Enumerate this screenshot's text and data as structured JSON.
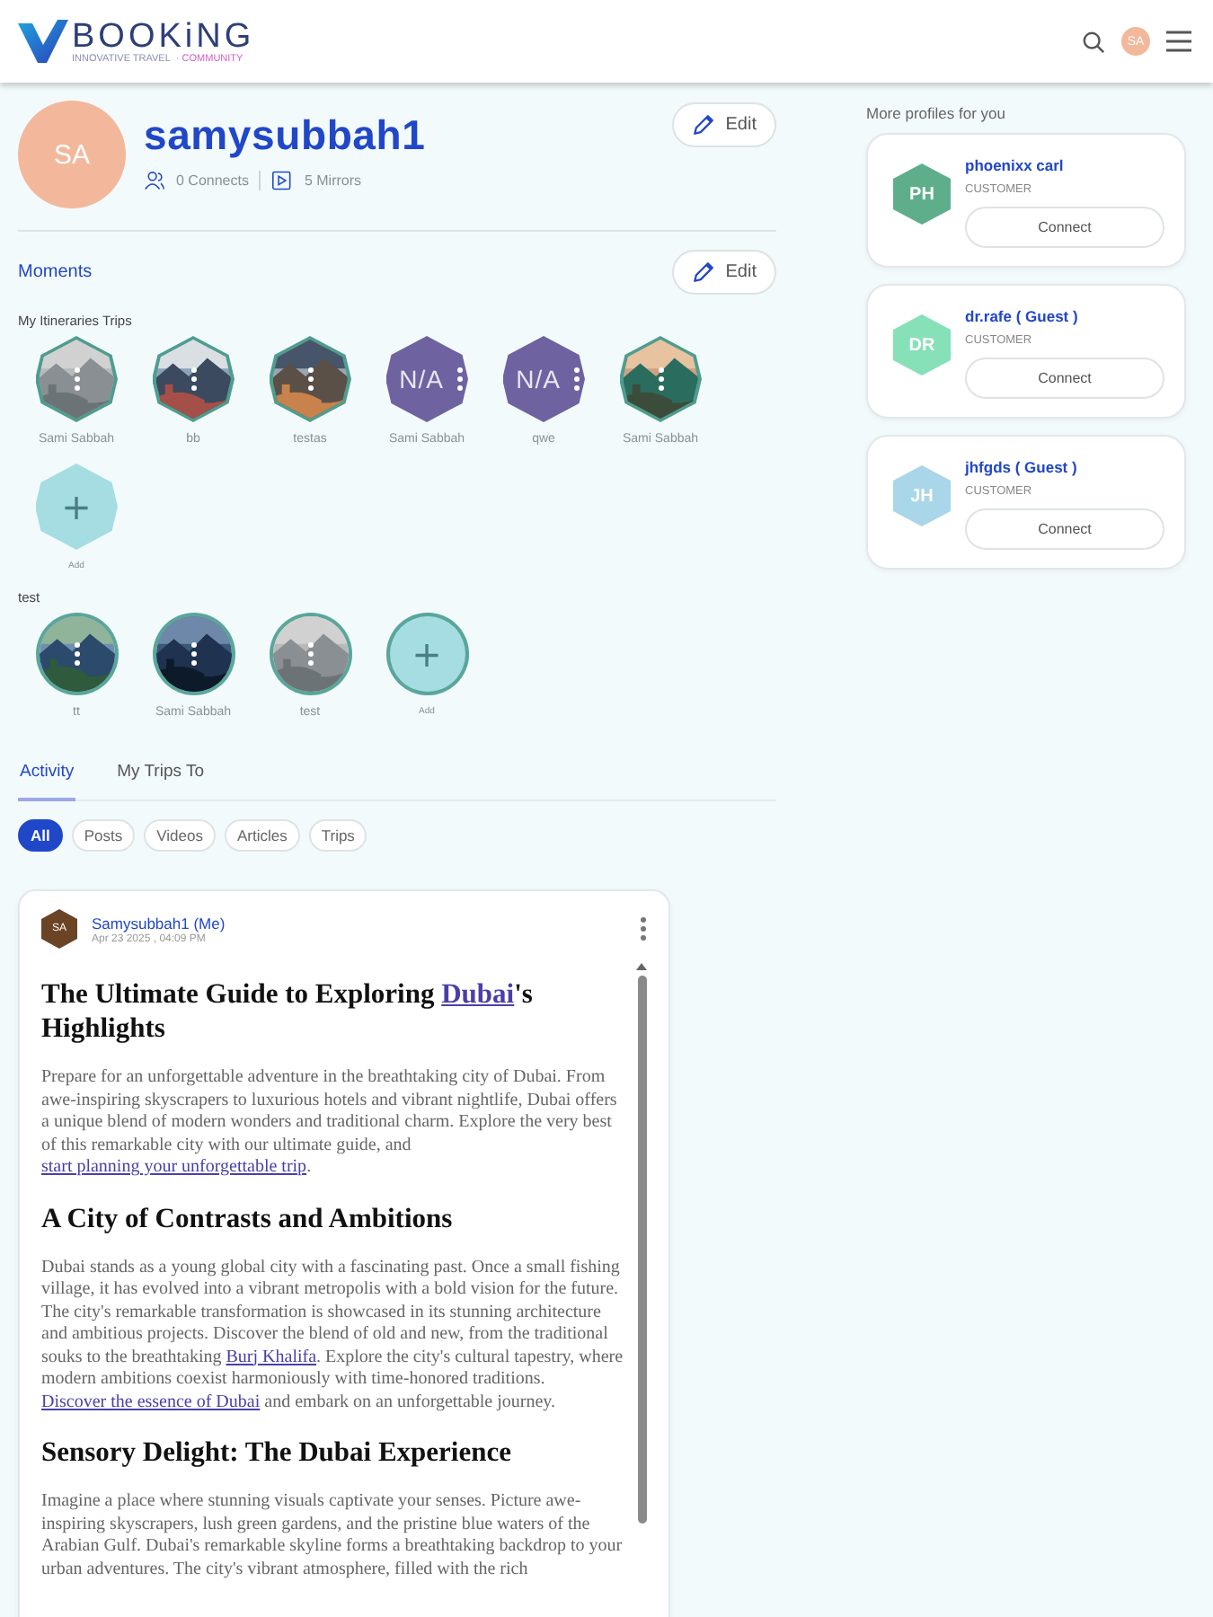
{
  "header": {
    "logo_text": "BOOKiNG",
    "tagline": "INNOVATIVE TRAVEL",
    "tagline_accent": "· COMMUNITY",
    "avatar_initials": "SA"
  },
  "profile": {
    "initials": "SA",
    "username": "samysubbah1",
    "stats": [
      {
        "kind": "connects",
        "text": "0 Connects"
      },
      {
        "kind": "mirrors",
        "text": "5 Mirrors"
      }
    ],
    "edit_label": "Edit"
  },
  "moments": {
    "title": "Moments",
    "edit_label": "Edit",
    "groups": [
      {
        "title": "My Itineraries Trips",
        "kind": "hexagon",
        "trips": [
          {
            "label": "Sami Sabbah"
          },
          {
            "label": "bb"
          },
          {
            "label": "testas"
          },
          {
            "kind": "none",
            "label": "Sami Sabbah",
            "cover_text": "N/A"
          },
          {
            "kind": "none",
            "label": "qwe",
            "cover_text": "N/A"
          },
          {
            "label": "Sami Sabbah"
          },
          {
            "kind": "add",
            "label": "Add",
            "icon": "+"
          }
        ]
      },
      {
        "title": "test",
        "kind": "circle",
        "trips": [
          {
            "label": "tt"
          },
          {
            "label": "Sami Sabbah"
          },
          {
            "label": "test"
          },
          {
            "kind": "add",
            "label": "Add",
            "icon": "+"
          }
        ]
      }
    ]
  },
  "tabs": [
    {
      "label": "Activity",
      "selected": true
    },
    {
      "label": "My Trips To",
      "selected": false
    }
  ],
  "filters": [
    {
      "label": "All",
      "selected": true
    },
    {
      "label": "Posts",
      "selected": false
    },
    {
      "label": "Videos",
      "selected": false
    },
    {
      "label": "Articles",
      "selected": false
    },
    {
      "label": "Trips",
      "selected": false
    }
  ],
  "post": {
    "author_initials": "SA",
    "author": "Samysubbah1 (Me)",
    "date": "Apr 23 2025 , 04:09 PM",
    "blocks": [
      {
        "kind": "heading",
        "parts": [
          {
            "kind": "text",
            "text": "The Ultimate Guide to Exploring "
          },
          {
            "kind": "link",
            "text": "Dubai"
          },
          {
            "kind": "text",
            "text": "'s Highlights"
          }
        ]
      },
      {
        "kind": "paragraph",
        "parts": [
          {
            "kind": "text",
            "text": "Prepare for an unforgettable adventure in the breathtaking city of Dubai. From awe-inspiring skyscrapers to luxurious hotels and vibrant nightlife, Dubai offers a unique blend of modern wonders and traditional charm. Explore the very best of this remarkable city with our ultimate guide, and "
          },
          {
            "kind": "link",
            "text": "start planning your unforgettable trip"
          },
          {
            "kind": "text",
            "text": "."
          }
        ]
      },
      {
        "kind": "heading",
        "parts": [
          {
            "kind": "text",
            "text": "A City of Contrasts and Ambitions"
          }
        ]
      },
      {
        "kind": "paragraph",
        "parts": [
          {
            "kind": "text",
            "text": "Dubai stands as a young global city with a fascinating past. Once a small fishing village, it has evolved into a vibrant metropolis with a bold vision for the future. The city's remarkable transformation is showcased in its stunning architecture and ambitious projects. Discover the blend of old and new, from the traditional souks to the breathtaking "
          },
          {
            "kind": "link",
            "text": "Burj Khalifa"
          },
          {
            "kind": "text",
            "text": ". Explore the city's cultural tapestry, where modern ambitions coexist harmoniously with time-honored traditions. "
          },
          {
            "kind": "link",
            "text": "Discover the essence of Dubai"
          },
          {
            "kind": "text",
            "text": " and embark on an unforgettable journey."
          }
        ]
      },
      {
        "kind": "heading",
        "parts": [
          {
            "kind": "text",
            "text": "Sensory Delight: The Dubai Experience"
          }
        ]
      },
      {
        "kind": "paragraph",
        "parts": [
          {
            "kind": "text",
            "text": "Imagine a place where stunning visuals captivate your senses. Picture awe-inspiring skyscrapers, lush green gardens, and the pristine blue waters of the Arabian Gulf. Dubai's remarkable skyline forms a breathtaking backdrop to your urban adventures. The city's vibrant atmosphere, filled with the rich"
          }
        ]
      }
    ]
  },
  "suggestions": {
    "title": "More profiles for you",
    "profiles": [
      {
        "initials": "PH",
        "name": "phoenixx carl",
        "role": "CUSTOMER",
        "color": "#5fae8b",
        "button": "Connect"
      },
      {
        "initials": "DR",
        "name": "dr.rafe ( Guest )",
        "role": "CUSTOMER",
        "color": "#86e0b8",
        "button": "Connect"
      },
      {
        "initials": "JH",
        "name": "jhfgds ( Guest )",
        "role": "CUSTOMER",
        "color": "#a9d6e8",
        "button": "Connect"
      }
    ]
  }
}
